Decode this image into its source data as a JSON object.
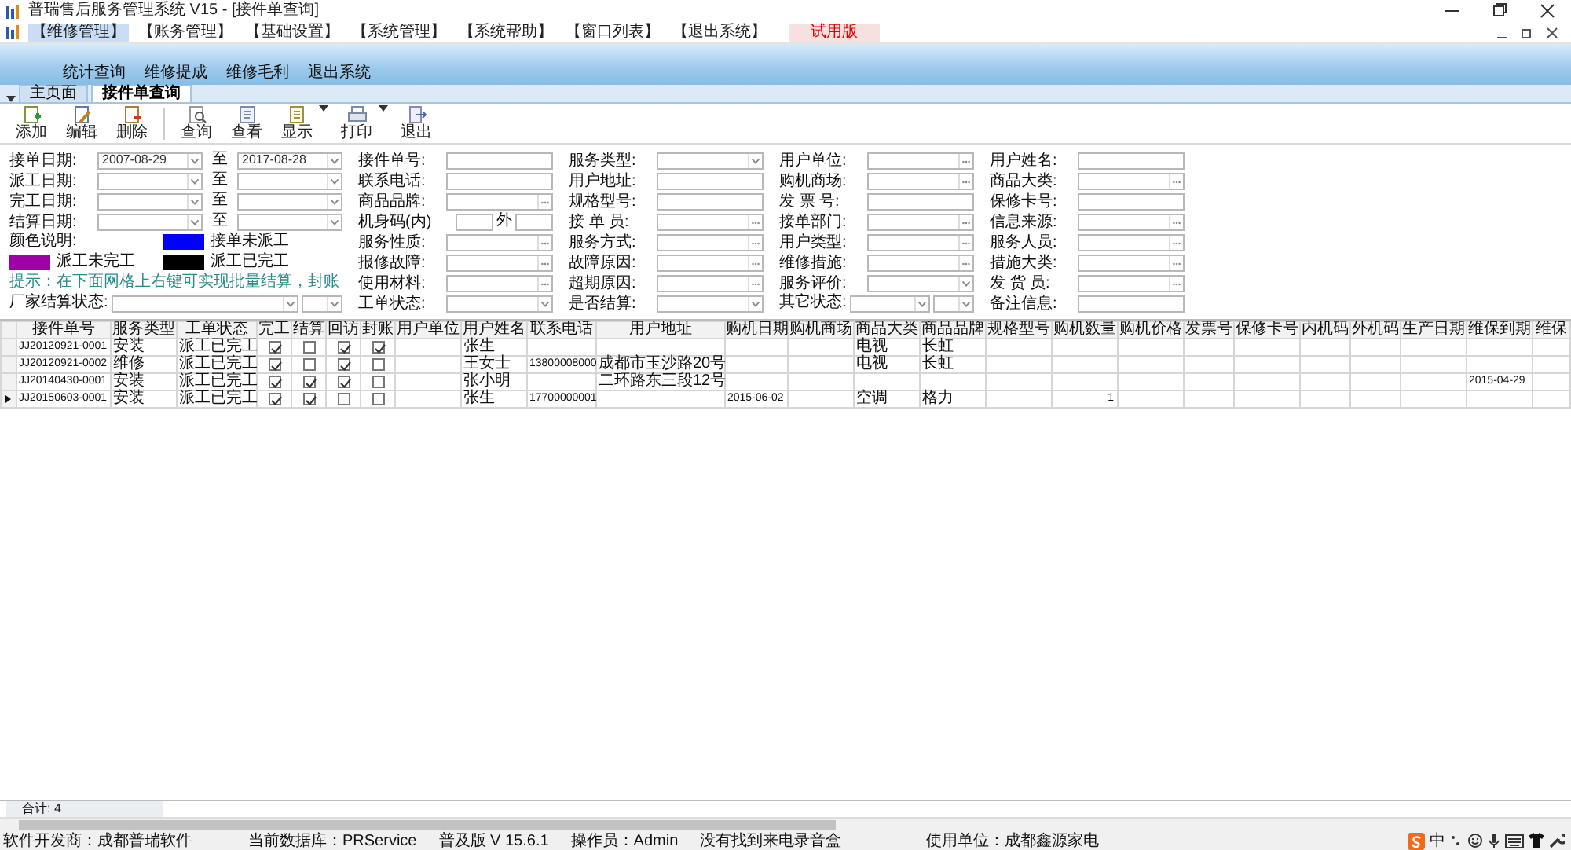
{
  "window": {
    "title": "普瑞售后服务管理系统 V15 - [接件单查询]"
  },
  "menu": [
    {
      "label": "【维修管理】",
      "selected": true
    },
    {
      "label": "【账务管理】",
      "selected": false
    },
    {
      "label": "【基础设置】",
      "selected": false
    },
    {
      "label": "【系统管理】",
      "selected": false
    },
    {
      "label": "【系统帮助】",
      "selected": false
    },
    {
      "label": "【窗口列表】",
      "selected": false
    },
    {
      "label": "【退出系统】",
      "selected": false
    }
  ],
  "trial_badge": "试用版",
  "ribbon": [
    "统计查询",
    "维修提成",
    "维修毛利",
    "退出系统"
  ],
  "tabs": [
    {
      "label": "主页面",
      "selected": false
    },
    {
      "label": "接件单查询",
      "selected": true
    }
  ],
  "toolbar": [
    {
      "label": "添加",
      "kind": "add"
    },
    {
      "label": "编辑",
      "kind": "edit"
    },
    {
      "label": "删除",
      "kind": "delete"
    },
    {
      "kind": "separator"
    },
    {
      "label": "查询",
      "kind": "query"
    },
    {
      "label": "查看",
      "kind": "view"
    },
    {
      "label": "显示",
      "kind": "display",
      "dropdown": true
    },
    {
      "label": "打印",
      "kind": "print",
      "dropdown": true
    },
    {
      "label": "退出",
      "kind": "exit"
    }
  ],
  "form": {
    "rows": [
      [
        {
          "kind": "daterange",
          "label": "接单日期:",
          "from": "2007-08-29",
          "sep": "至",
          "to": "2017-08-28"
        },
        {
          "kind": "text",
          "label": "接件单号:"
        },
        {
          "kind": "combo",
          "label": "服务类型:"
        },
        {
          "kind": "lookup",
          "label": "用户单位:"
        },
        {
          "kind": "text",
          "label": "用户姓名:"
        }
      ],
      [
        {
          "kind": "daterange",
          "label": "派工日期:",
          "sep": "至"
        },
        {
          "kind": "text",
          "label": "联系电话:"
        },
        {
          "kind": "text",
          "label": "用户地址:"
        },
        {
          "kind": "lookup",
          "label": "购机商场:"
        },
        {
          "kind": "lookup",
          "label": "商品大类:"
        }
      ],
      [
        {
          "kind": "daterange",
          "label": "完工日期:",
          "sep": "至"
        },
        {
          "kind": "lookup",
          "label": "商品品牌:"
        },
        {
          "kind": "text",
          "label": "规格型号:"
        },
        {
          "kind": "text",
          "label": "发 票 号:"
        },
        {
          "kind": "text",
          "label": "保修卡号:"
        }
      ],
      [
        {
          "kind": "daterange",
          "label": "结算日期:",
          "sep": "至"
        },
        {
          "kind": "dual",
          "label": "机身码(内)",
          "label2": "外"
        },
        {
          "kind": "lookup",
          "label": "接 单 员:"
        },
        {
          "kind": "lookup",
          "label": "接单部门:"
        },
        {
          "kind": "lookup",
          "label": "信息来源:"
        }
      ],
      [
        {
          "kind": "legend",
          "label": "颜色说明:",
          "items": [
            {
              "label": "接单未派工",
              "color": "#0000ff"
            }
          ]
        },
        {
          "kind": "lookup",
          "label": "服务性质:"
        },
        {
          "kind": "lookup",
          "label": "服务方式:"
        },
        {
          "kind": "lookup",
          "label": "用户类型:"
        },
        {
          "kind": "lookup",
          "label": "服务人员:"
        }
      ],
      [
        {
          "kind": "legend",
          "items": [
            {
              "label": "派工未完工",
              "color": "#a000a8"
            },
            {
              "label": "派工已完工",
              "color": "#000000"
            }
          ]
        },
        {
          "kind": "lookup",
          "label": "报修故障:"
        },
        {
          "kind": "lookup",
          "label": "故障原因:"
        },
        {
          "kind": "lookup",
          "label": "维修措施:"
        },
        {
          "kind": "lookup",
          "label": "措施大类:"
        }
      ],
      [
        {
          "kind": "hint",
          "text": "提示：在下面网格上右键可实现批量结算，封账"
        },
        {
          "kind": "lookup",
          "label": "使用材料:"
        },
        {
          "kind": "lookup",
          "label": "超期原因:"
        },
        {
          "kind": "combo",
          "label": "服务评价:"
        },
        {
          "kind": "lookup",
          "label": "发 货 员:"
        }
      ],
      [
        {
          "kind": "combo2",
          "label": "厂家结算状态:"
        },
        {
          "kind": "combo",
          "label": "工单状态:"
        },
        {
          "kind": "combo",
          "label": "是否结算:"
        },
        {
          "kind": "combo2",
          "label": "其它状态:"
        },
        {
          "kind": "text",
          "label": "备注信息:"
        }
      ]
    ]
  },
  "table": {
    "columns": [
      {
        "label": "接件单号",
        "kind": "code"
      },
      {
        "label": "服务类型",
        "kind": "text"
      },
      {
        "label": "工单状态",
        "kind": "text"
      },
      {
        "label": "完工",
        "kind": "check"
      },
      {
        "label": "结算",
        "kind": "check"
      },
      {
        "label": "回访",
        "kind": "check"
      },
      {
        "label": "封账",
        "kind": "check"
      },
      {
        "label": "用户单位",
        "kind": "text"
      },
      {
        "label": "用户姓名",
        "kind": "text"
      },
      {
        "label": "联系电话",
        "kind": "code"
      },
      {
        "label": "用户地址",
        "kind": "text"
      },
      {
        "label": "购机日期",
        "kind": "code"
      },
      {
        "label": "购机商场",
        "kind": "text"
      },
      {
        "label": "商品大类",
        "kind": "text"
      },
      {
        "label": "商品品牌",
        "kind": "text"
      },
      {
        "label": "规格型号",
        "kind": "text"
      },
      {
        "label": "购机数量",
        "kind": "num"
      },
      {
        "label": "购机价格",
        "kind": "num"
      },
      {
        "label": "发票号",
        "kind": "text"
      },
      {
        "label": "保修卡号",
        "kind": "text"
      },
      {
        "label": "内机码",
        "kind": "text"
      },
      {
        "label": "外机码",
        "kind": "text"
      },
      {
        "label": "生产日期",
        "kind": "code"
      },
      {
        "label": "维保到期",
        "kind": "code"
      },
      {
        "label": "维保",
        "kind": "text"
      }
    ],
    "rows": [
      {
        "selected": false,
        "cells": [
          {
            "text": "JJ20120921-0001"
          },
          {
            "text": "安装"
          },
          {
            "text": "派工已完工"
          },
          {
            "checked": true
          },
          {
            "checked": false
          },
          {
            "checked": true
          },
          {
            "checked": true
          },
          {},
          {
            "text": "张生"
          },
          {},
          {},
          {},
          {},
          {
            "text": "电视"
          },
          {
            "text": "长虹"
          }
        ]
      },
      {
        "selected": false,
        "cells": [
          {
            "text": "JJ20120921-0002"
          },
          {
            "text": "维修"
          },
          {
            "text": "派工已完工"
          },
          {
            "checked": true
          },
          {
            "checked": false
          },
          {
            "checked": true
          },
          {
            "checked": false
          },
          {},
          {
            "text": "王女士"
          },
          {
            "text": "13800008000"
          },
          {
            "text": "成都市玉沙路20号"
          },
          {},
          {},
          {
            "text": "电视"
          },
          {
            "text": "长虹"
          }
        ]
      },
      {
        "selected": false,
        "cells": [
          {
            "text": "JJ20140430-0001"
          },
          {
            "text": "安装"
          },
          {
            "text": "派工已完工"
          },
          {
            "checked": true
          },
          {
            "checked": true
          },
          {
            "checked": true
          },
          {
            "checked": false
          },
          {},
          {
            "text": "张小明"
          },
          {},
          {
            "text": "二环路东三段12号"
          },
          {},
          {},
          {},
          {},
          {},
          {},
          {},
          {},
          {},
          {},
          {},
          {},
          {
            "text": "2015-04-29"
          }
        ]
      },
      {
        "selected": true,
        "cells": [
          {
            "text": "JJ20150603-0001"
          },
          {
            "text": "安装"
          },
          {
            "text": "派工已完工"
          },
          {
            "checked": true
          },
          {
            "checked": true
          },
          {
            "checked": false
          },
          {
            "checked": false
          },
          {},
          {
            "text": "张生"
          },
          {
            "text": "17700000001"
          },
          {},
          {
            "text": "2015-06-02"
          },
          {},
          {
            "text": "空调"
          },
          {
            "text": "格力"
          },
          {},
          {
            "text": "1"
          }
        ]
      }
    ]
  },
  "total": "合计: 4",
  "status_bar": [
    "软件开发商：成都普瑞软件",
    "当前数据库：PRService",
    "普及版 V 15.6.1",
    "操作员：Admin",
    "没有找到来电录音盒",
    "使用单位：成都鑫源家电"
  ],
  "ime": {
    "mode": "中"
  }
}
